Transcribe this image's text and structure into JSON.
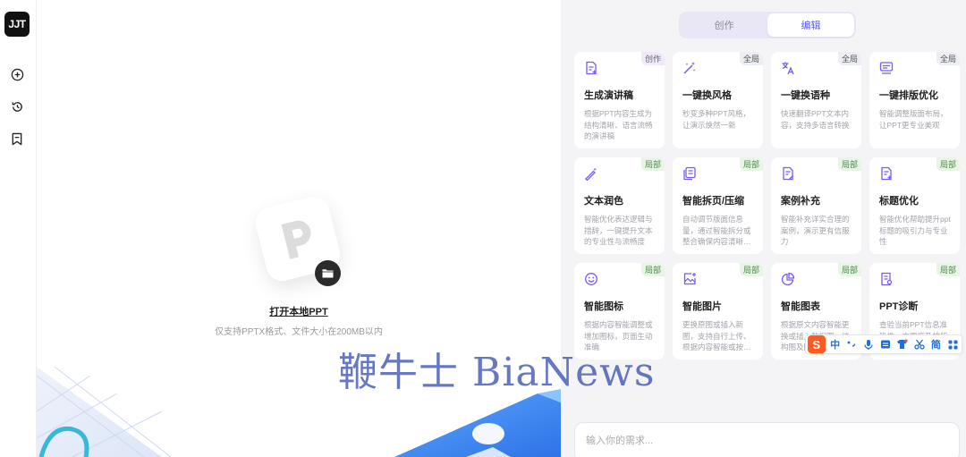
{
  "sidebar": {
    "logo_text": "JJT",
    "items": [
      {
        "name": "new-plus-icon"
      },
      {
        "name": "history-icon"
      },
      {
        "name": "bookmark-icon"
      }
    ]
  },
  "upload": {
    "open_label": "打开本地PPT",
    "note": "仅支持PPTX格式、文件大小在200MB以内"
  },
  "tabs": [
    {
      "label": "创作",
      "active": false
    },
    {
      "label": "编辑",
      "active": true
    }
  ],
  "cards": [
    {
      "title": "生成演讲稿",
      "badge": "创作",
      "desc": "根据PPT内容生成为结构清晰、语言流畅的演讲稿",
      "icon": "speech-doc-icon"
    },
    {
      "title": "一键换风格",
      "badge": "全局",
      "desc": "秒变多种PPT风格，让演示焕然一新",
      "icon": "magic-wand-icon"
    },
    {
      "title": "一键换语种",
      "badge": "全局",
      "desc": "快速翻译PPT文本内容，支持多语言转换",
      "icon": "translate-icon"
    },
    {
      "title": "一键排版优化",
      "badge": "全局",
      "desc": "智能调整版面布局，让PPT更专业美观",
      "icon": "layout-icon"
    },
    {
      "title": "文本润色",
      "badge": "局部",
      "desc": "智能优化表达逻辑与措辞，一键提升文本的专业性与流畅度",
      "icon": "text-polish-icon"
    },
    {
      "title": "智能拆页/压缩",
      "badge": "局部",
      "desc": "自动调节版面信息量，通过智能拆分或整合确保内容清晰呈现",
      "icon": "split-pages-icon"
    },
    {
      "title": "案例补充",
      "badge": "局部",
      "desc": "智能补充详实合理的案例，演示更有信服力",
      "icon": "case-doc-icon"
    },
    {
      "title": "标题优化",
      "badge": "局部",
      "desc": "智能优化帮助提升ppt标题的吸引力与专业性",
      "icon": "title-doc-icon"
    },
    {
      "title": "智能图标",
      "badge": "局部",
      "desc": "根据内容智能调整或增加图标，页面生动准确",
      "icon": "smiley-icon"
    },
    {
      "title": "智能图片",
      "badge": "局部",
      "desc": "更换原图或插入新图，支持自行上传、根据内容智能或按需生成",
      "icon": "image-add-icon"
    },
    {
      "title": "智能图表",
      "badge": "局部",
      "desc": "根据原文内容智能更换或插入数据图、结构图及图表",
      "icon": "chart-pie-icon"
    },
    {
      "title": "PPT诊断",
      "badge": "局部",
      "desc": "查验当前PPT信息准确性、丰富度及排版问题",
      "icon": "diagnose-doc-icon"
    }
  ],
  "input": {
    "placeholder": "输入你的需求..."
  },
  "ime": {
    "logo": "S",
    "lang": "中",
    "simp": "简"
  },
  "watermark": "鞭牛士 BiaNews",
  "colors": {
    "accent": "#5b5be6",
    "icon_purple": "#7a5af0",
    "badge_local_text": "#4a8a45"
  }
}
